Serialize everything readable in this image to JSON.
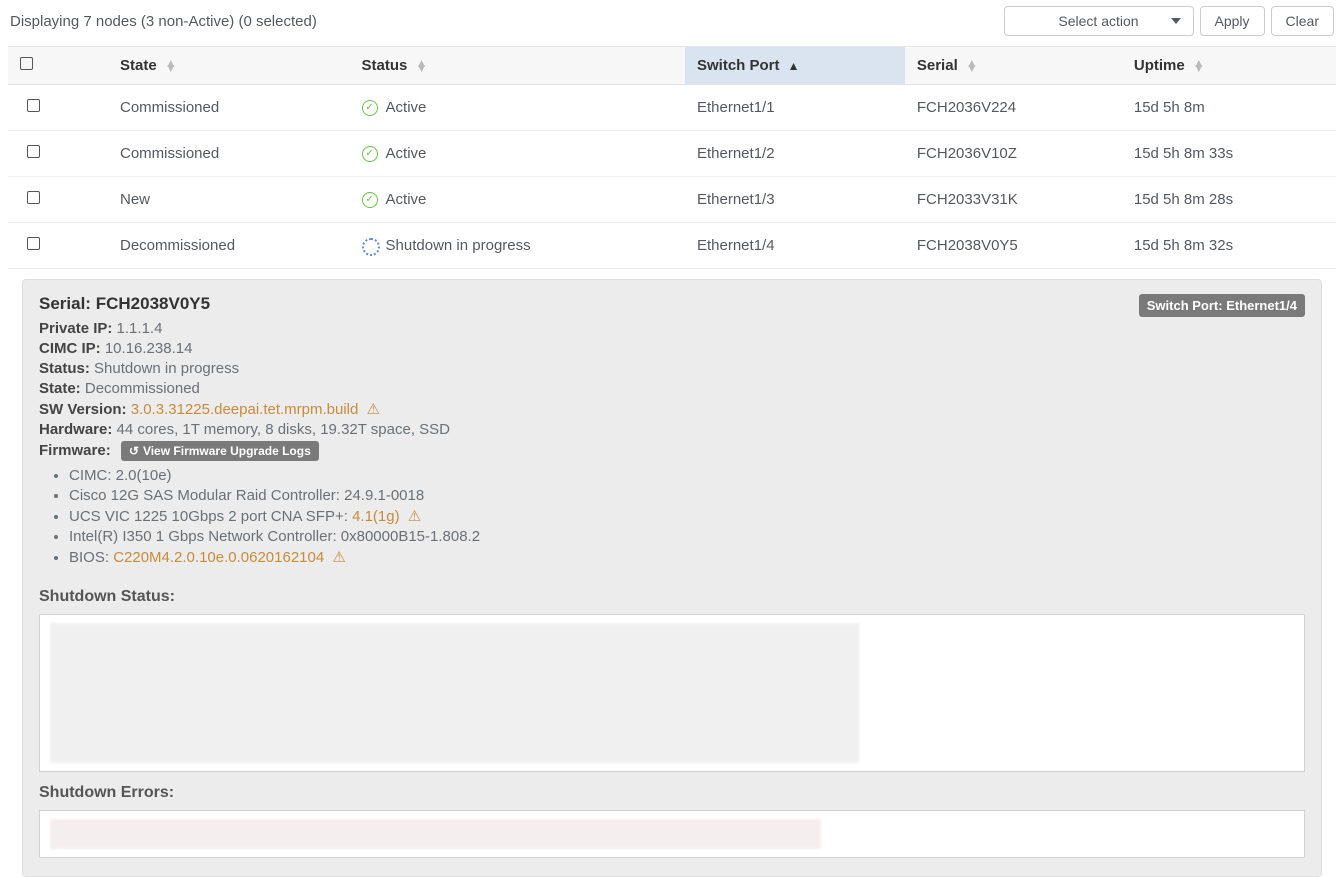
{
  "header": {
    "displaying": "Displaying 7 nodes (3 non-Active) (0 selected)",
    "select_action": "Select action",
    "apply": "Apply",
    "clear": "Clear"
  },
  "columns": {
    "state": "State",
    "status": "Status",
    "switch_port": "Switch Port",
    "serial": "Serial",
    "uptime": "Uptime"
  },
  "rows": [
    {
      "state": "Commissioned",
      "status": "Active",
      "status_icon": "check",
      "port": "Ethernet1/1",
      "serial": "FCH2036V224",
      "uptime": "15d 5h 8m"
    },
    {
      "state": "Commissioned",
      "status": "Active",
      "status_icon": "check",
      "port": "Ethernet1/2",
      "serial": "FCH2036V10Z",
      "uptime": "15d 5h 8m 33s"
    },
    {
      "state": "New",
      "status": "Active",
      "status_icon": "check",
      "port": "Ethernet1/3",
      "serial": "FCH2033V31K",
      "uptime": "15d 5h 8m 28s"
    },
    {
      "state": "Decommissioned",
      "status": "Shutdown in progress",
      "status_icon": "spinner",
      "port": "Ethernet1/4",
      "serial": "FCH2038V0Y5",
      "uptime": "15d 5h 8m 32s"
    }
  ],
  "detail": {
    "serial_label": "Serial:",
    "serial": "FCH2038V0Y5",
    "badge": "Switch Port: Ethernet1/4",
    "private_ip_label": "Private IP:",
    "private_ip": "1.1.1.4",
    "cimc_ip_label": "CIMC IP:",
    "cimc_ip": "10.16.238.14",
    "status_label": "Status:",
    "status": "Shutdown in progress",
    "state_label": "State:",
    "state": "Decommissioned",
    "sw_version_label": "SW Version:",
    "sw_version": "3.0.3.31225.deepai.tet.mrpm.build",
    "hardware_label": "Hardware:",
    "hardware": "44 cores, 1T memory, 8 disks, 19.32T space, SSD",
    "firmware_label": "Firmware:",
    "fw_button": "View Firmware Upgrade Logs",
    "fw_items": {
      "cimc_label": "CIMC:",
      "cimc": "2.0(10e)",
      "raid_label": "Cisco 12G SAS Modular Raid Controller:",
      "raid": "24.9.1-0018",
      "vic_label": "UCS VIC 1225 10Gbps 2 port CNA SFP+:",
      "vic": "4.1(1g)",
      "intel_label": "Intel(R) I350 1 Gbps Network Controller:",
      "intel": "0x80000B15-1.808.2",
      "bios_label": "BIOS:",
      "bios": "C220M4.2.0.10e.0.0620162104"
    },
    "shutdown_status_h": "Shutdown Status:",
    "shutdown_errors_h": "Shutdown Errors:"
  }
}
